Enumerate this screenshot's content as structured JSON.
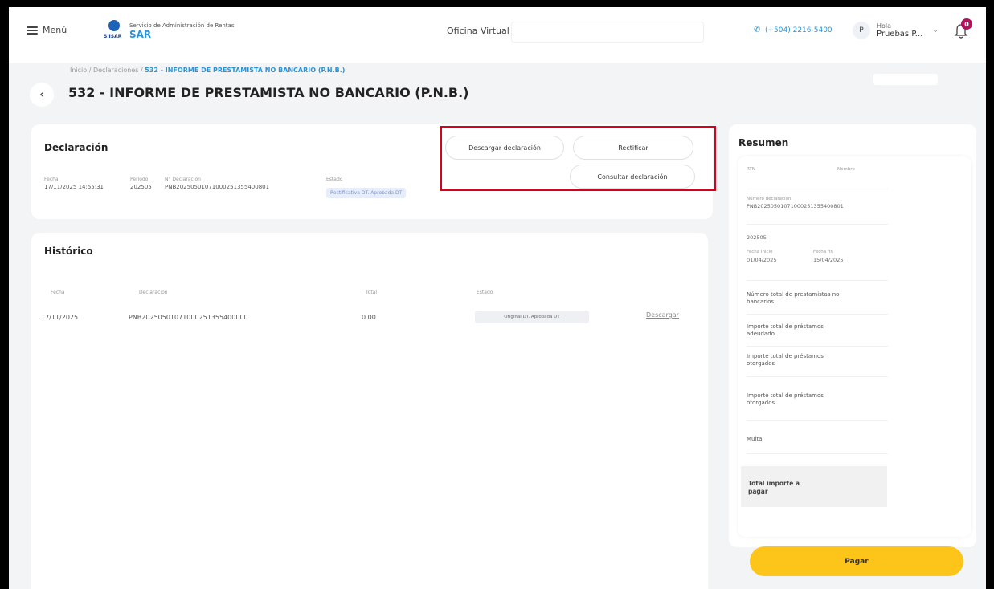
{
  "header": {
    "menu_label": "Menú",
    "logo_tiny": "SIISAR",
    "org_name": "Servicio de Administración de Rentas",
    "org_short": "SAR",
    "office_label": "Oficina Virtual",
    "phone": "(+504) 2216-5400",
    "avatar_initial": "P",
    "greeting": "Hola",
    "user_name": "Pruebas P...",
    "notifications": "0"
  },
  "title_area": {
    "breadcrumb_prefix": "Inicio / Declaraciones / ",
    "breadcrumb_current": "532 - INFORME DE PRESTAMISTA NO BANCARIO (P.N.B.)",
    "page_title": "532 - INFORME DE PRESTAMISTA NO BANCARIO (P.N.B.)"
  },
  "declaracion": {
    "title": "Declaración",
    "fields": [
      {
        "label": "Fecha",
        "value": "17/11/2025 14:55:31"
      },
      {
        "label": "Período",
        "value": "202505"
      },
      {
        "label": "N° Declaración",
        "value": "PNB20250501071000251355400801"
      },
      {
        "label": "Estado",
        "value": "Rectificativa DT. Aprobada DT"
      }
    ],
    "buttons": {
      "download": "Descargar declaración",
      "rectify": "Rectificar",
      "consult": "Consultar declaración"
    }
  },
  "historico": {
    "title": "Histórico",
    "columns": [
      "Fecha",
      "Declaración",
      "Total",
      "Estado"
    ],
    "rows": [
      {
        "fecha": "17/11/2025",
        "declaracion": "PNB20250501071000251355400000",
        "total": "0.00",
        "estado": "Original DT. Aprobada DT",
        "action": "Descargar"
      }
    ]
  },
  "resumen": {
    "title": "Resumen",
    "rtn_label": "RTN",
    "nombre_label": "Nombre",
    "num_decl_label": "Número declaración",
    "num_decl_value": "PNB20250501071000251355400801",
    "period_value": "202505",
    "fecha_inicio_label": "Fecha Inicio",
    "fecha_inicio_value": "01/04/2025",
    "fecha_fin_label": "Fecha fin",
    "fecha_fin_value": "15/04/2025",
    "items": [
      "Número total de prestamistas no bancarios",
      "Importe total de préstamos adeudado",
      "Importe total de préstamos otorgados",
      "Importe total de préstamos otorgados",
      "Multa"
    ],
    "total_label": "Total importe a pagar",
    "pay_label": "Pagar"
  }
}
